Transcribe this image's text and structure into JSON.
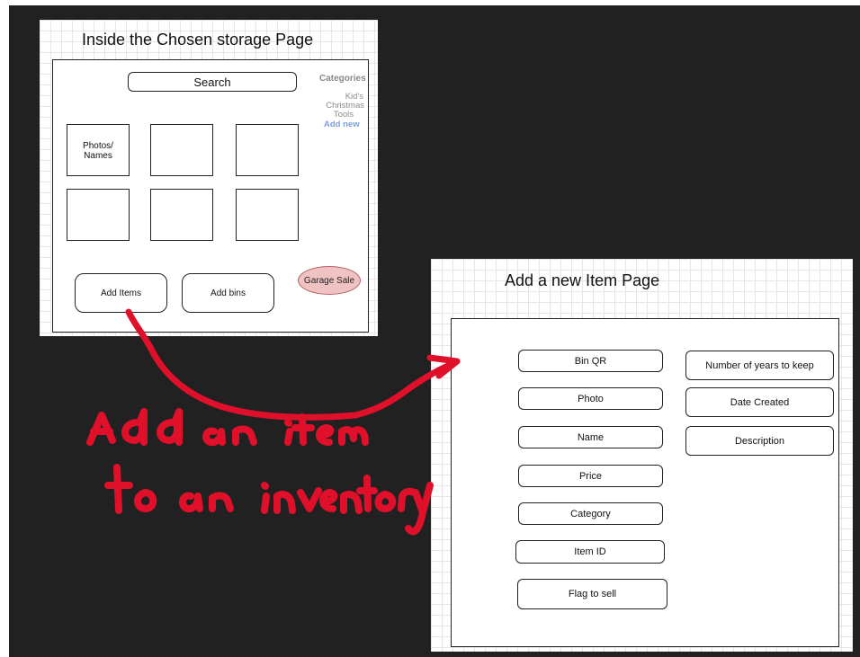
{
  "storage_page": {
    "title": "Inside the Chosen storage Page",
    "search_label": "Search",
    "categories": {
      "heading": "Categories",
      "items": [
        "Kid's",
        "Christmas",
        "Tools"
      ],
      "add_new": "Add new"
    },
    "tile_label": "Photos/\nNames",
    "add_items_label": "Add Items",
    "add_bins_label": "Add bins",
    "garage_sale_label": "Garage Sale"
  },
  "item_page": {
    "title": "Add a new Item Page",
    "left_fields": [
      "Bin QR",
      "Photo",
      "Name",
      "Price",
      "Category",
      "Item ID",
      "Flag to sell"
    ],
    "right_fields": [
      "Number of years to keep",
      "Date Created",
      "Description"
    ]
  },
  "annotation": {
    "color": "#e0102a"
  }
}
